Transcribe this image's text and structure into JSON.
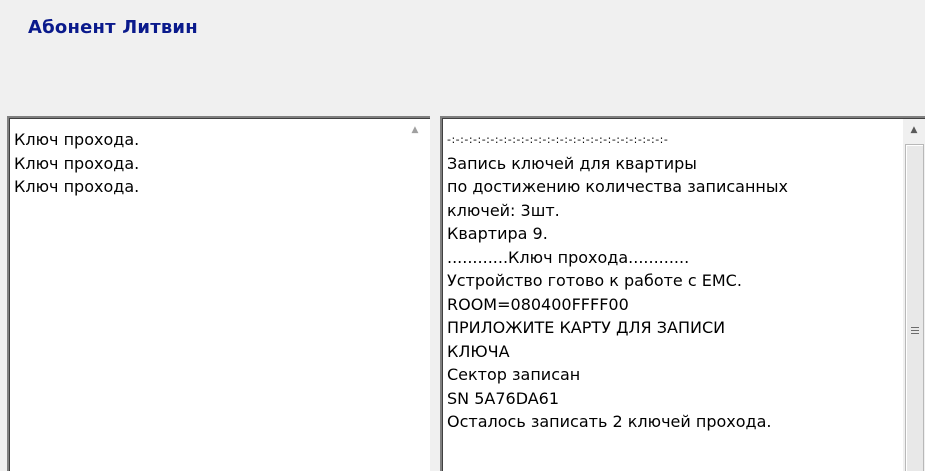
{
  "header": {
    "title": "Абонент Литвин"
  },
  "left_log": {
    "lines": [
      "Ключ прохода.",
      "Ключ прохода.",
      "Ключ прохода."
    ],
    "scroll_up_icon": "▲"
  },
  "right_log": {
    "lines": [
      "-:-:-:-:-:-:-:-:-:-:-:-:-:-:-:-:-:-:-:-:-:-:-:-:-:-",
      "Запись ключей для квартиры",
      "по достижению количества записанных",
      "ключей: 3шт.",
      "Квартира 9.",
      "............Ключ прохода............",
      "Устройство готово к работе с ЕМС.",
      "ROOM=080400FFFF00",
      "ПРИЛОЖИТЕ КАРТУ ДЛЯ ЗАПИСИ",
      "КЛЮЧА",
      "Сектор записан",
      "SN 5A76DA61",
      "Осталось записать 2 ключей прохода."
    ],
    "scroll_up_icon": "▲"
  }
}
